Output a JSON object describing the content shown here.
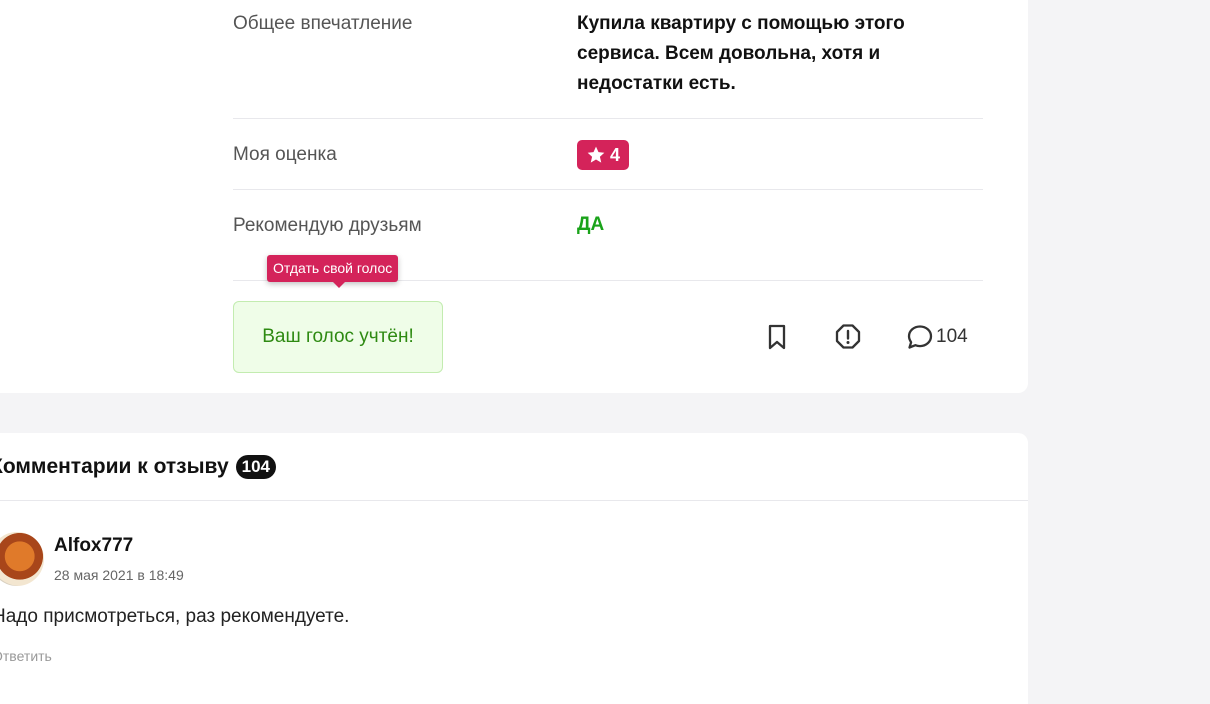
{
  "review": {
    "impression_label": "Общее впечатление",
    "impression_text": "Купила квартиру с помощью этого сервиса. Всем довольна, хотя и недостатки есть.",
    "rating_label": "Моя оценка",
    "rating_value": "4",
    "recommend_label": "Рекомендую друзьям",
    "recommend_value": "ДА"
  },
  "tooltip": {
    "text": "Отдать свой голос"
  },
  "vote": {
    "status_text": "Ваш голос учтён!"
  },
  "actions": {
    "bookmark_icon": "bookmark-icon",
    "report_icon": "report-icon",
    "comments_icon": "comment-icon",
    "comments_count": "104"
  },
  "comments": {
    "header": "Комментарии к отзыву",
    "count": "104",
    "items": [
      {
        "author": "Alfox777",
        "date": "28 мая 2021 в 18:49",
        "text": "Надо присмотреться, раз рекомендуете.",
        "reply_label": "Ответить"
      }
    ]
  },
  "colors": {
    "accent": "#d4235a",
    "recommend_green": "#1aa31a",
    "vote_bg": "#effde8",
    "vote_text": "#2e8a12"
  }
}
